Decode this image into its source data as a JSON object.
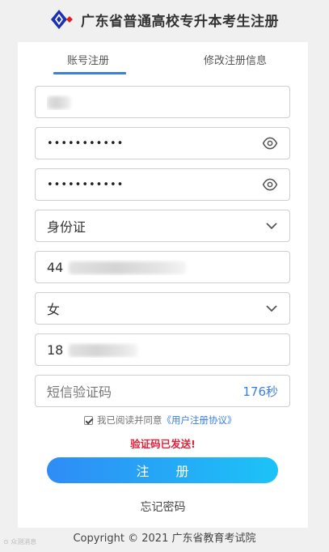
{
  "header": {
    "title": "广东省普通高校专升本考生注册",
    "logo_icon": "diamond-logo-icon",
    "colors": {
      "logo_blue": "#1a2fb5",
      "logo_red": "#e02020"
    }
  },
  "tabs": [
    {
      "label": "账号注册",
      "active": true
    },
    {
      "label": "修改注册信息",
      "active": false
    }
  ],
  "form": {
    "account_value_blurred": true,
    "password_value": "•••••••••••",
    "confirm_password_value": "•••••••••••",
    "id_type_selected": "身份证",
    "id_number_prefix": "44",
    "gender_selected": "女",
    "phone_prefix": "18",
    "sms_placeholder": "短信验证码",
    "sms_countdown": "176秒"
  },
  "agreement": {
    "checked": true,
    "text": "我已阅读并同意",
    "link": "《用户注册协议》"
  },
  "status_message": "验证码已发送!",
  "register_label": "注 册",
  "forgot_label": "忘记密码",
  "footer": "Copyright © 2021 广东省教育考试院",
  "watermark": "⊙ 众测消息",
  "colors": {
    "accent": "#3a7fe0",
    "error": "#e0223a",
    "button_start": "#2f8cf6",
    "button_end": "#1cc3f7"
  }
}
